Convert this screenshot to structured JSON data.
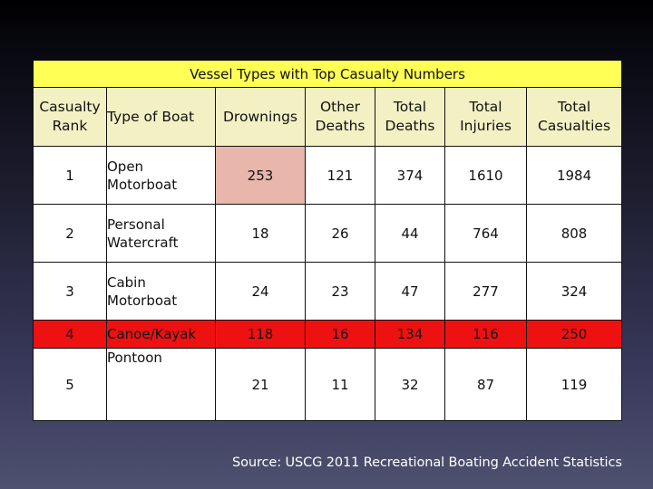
{
  "table": {
    "title": "Vessel Types with Top Casualty Numbers",
    "columns": [
      [
        "Casualty",
        "Rank"
      ],
      [
        "Type of Boat"
      ],
      [
        "Drownings"
      ],
      [
        "Other",
        "Deaths"
      ],
      [
        "Total",
        "Deaths"
      ],
      [
        "Total",
        "Injuries"
      ],
      [
        "Total",
        "Casualties"
      ]
    ],
    "rows": [
      {
        "rank": "1",
        "boat": [
          "Open",
          "Motorboat"
        ],
        "drownings": "253",
        "other_deaths": "121",
        "total_deaths": "374",
        "total_injuries": "1610",
        "total_casualties": "1984"
      },
      {
        "rank": "2",
        "boat": [
          "Personal",
          "Watercraft"
        ],
        "drownings": "18",
        "other_deaths": "26",
        "total_deaths": "44",
        "total_injuries": "764",
        "total_casualties": "808"
      },
      {
        "rank": "3",
        "boat": [
          "Cabin",
          "Motorboat"
        ],
        "drownings": "24",
        "other_deaths": "23",
        "total_deaths": "47",
        "total_injuries": "277",
        "total_casualties": "324"
      },
      {
        "rank": "4",
        "boat": [
          "Canoe/Kayak"
        ],
        "drownings": "118",
        "other_deaths": "16",
        "total_deaths": "134",
        "total_injuries": "116",
        "total_casualties": "250"
      },
      {
        "rank": "5",
        "boat": [
          "Pontoon"
        ],
        "drownings": "21",
        "other_deaths": "11",
        "total_deaths": "32",
        "total_injuries": "87",
        "total_casualties": "119"
      }
    ],
    "highlight_colors": {
      "title_bg": "#ffff55",
      "header_bg": "#f3f1c4",
      "drownings_rank1_bg": "#e8b6aa",
      "row4_bg": "#ee1111"
    }
  },
  "source": "Source: USCG 2011 Recreational Boating Accident Statistics"
}
